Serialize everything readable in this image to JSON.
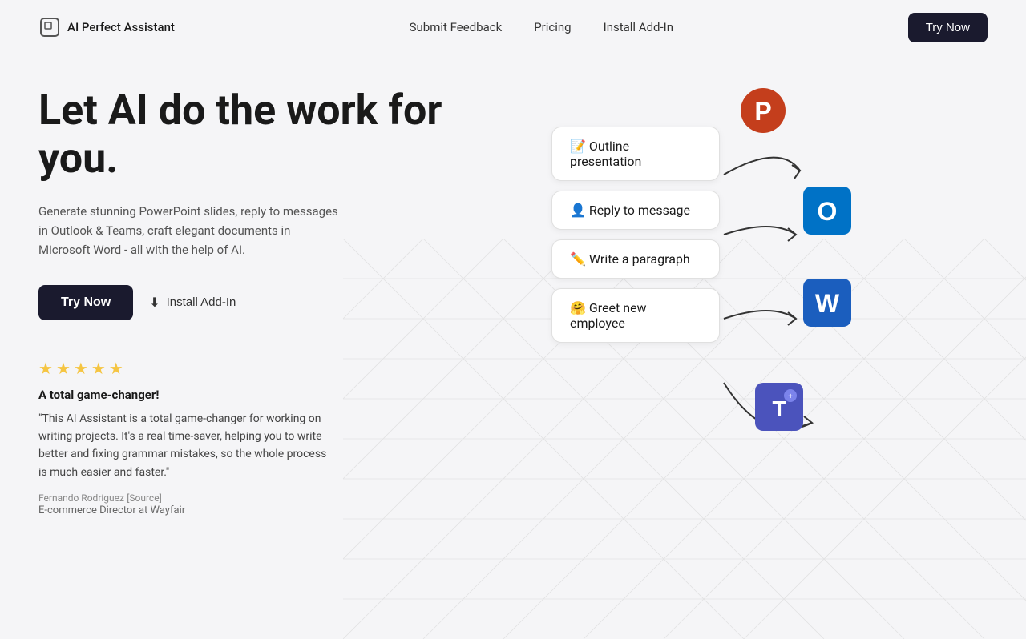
{
  "nav": {
    "logo_text": "AI Perfect Assistant",
    "links": [
      {
        "label": "Submit Feedback",
        "id": "submit-feedback"
      },
      {
        "label": "Pricing",
        "id": "pricing"
      },
      {
        "label": "Install Add-In",
        "id": "install-addon"
      }
    ],
    "try_now": "Try Now"
  },
  "hero": {
    "title": "Let AI do the work for you.",
    "subtitle": "Generate stunning PowerPoint slides, reply to messages in Outlook & Teams, craft elegant documents in Microsoft Word - all with the help of AI.",
    "cta_primary": "Try Now",
    "cta_secondary": "Install Add-In"
  },
  "review": {
    "stars": [
      "★",
      "★",
      "★",
      "★",
      "★"
    ],
    "title": "A total game-changer!",
    "text": "\"This AI Assistant is a total game-changer for working on writing projects. It's a real time-saver, helping you to write better and fixing grammar mistakes, so the whole process is much easier and faster.\"",
    "reviewer_name": "Fernando Rodriguez",
    "reviewer_source": "[Source]",
    "reviewer_title": "E-commerce Director at Wayfair"
  },
  "action_cards": [
    {
      "id": "outline",
      "label": "📝 Outline presentation"
    },
    {
      "id": "reply",
      "label": "👤 Reply to message"
    },
    {
      "id": "paragraph",
      "label": "✏️ Write a paragraph"
    },
    {
      "id": "greet",
      "label": "🤗 Greet new employee"
    }
  ],
  "colors": {
    "dark_btn": "#1a1a2e",
    "star_color": "#f5c542",
    "bg": "#f5f5f7"
  }
}
